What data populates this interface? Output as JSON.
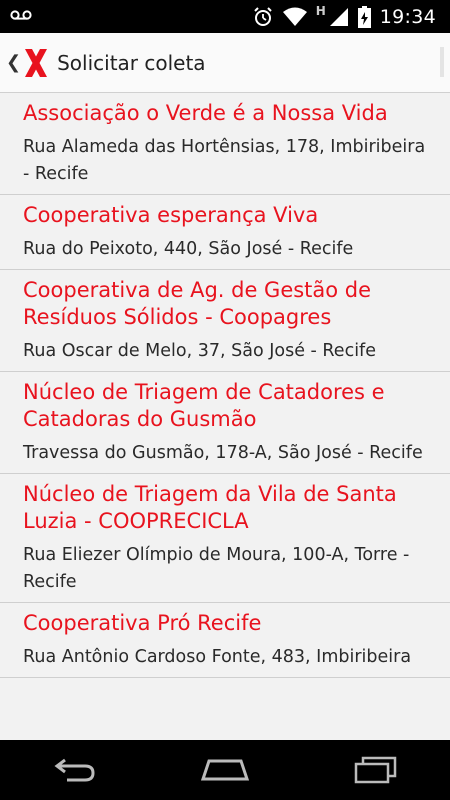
{
  "status_bar": {
    "time": "19:34",
    "network_type": "H"
  },
  "action_bar": {
    "title": "Solicitar coleta"
  },
  "cooperatives": [
    {
      "name": "Associação o Verde é a Nossa Vida",
      "address": "Rua Alameda das Hortênsias, 178, Imbiribeira - Recife"
    },
    {
      "name": "Cooperativa esperança Viva",
      "address": "Rua do Peixoto, 440, São José - Recife"
    },
    {
      "name": "Cooperativa de Ag. de Gestão de Resíduos Sólidos - Coopagres",
      "address": "Rua Oscar de Melo, 37, São José - Recife"
    },
    {
      "name": "Núcleo de Triagem de Catadores e Catadoras do Gusmão",
      "address": "Travessa do Gusmão, 178-A, São José - Recife"
    },
    {
      "name": "Núcleo de Triagem da Vila de Santa Luzia - COOPRECICLA",
      "address": "Rua Eliezer Olímpio de Moura, 100-A, Torre - Recife"
    },
    {
      "name": "Cooperativa Pró Recife",
      "address": "Rua Antônio Cardoso  Fonte, 483, Imbiribeira"
    }
  ],
  "colors": {
    "accent": "#e8131e",
    "background": "#f2f2f2"
  }
}
